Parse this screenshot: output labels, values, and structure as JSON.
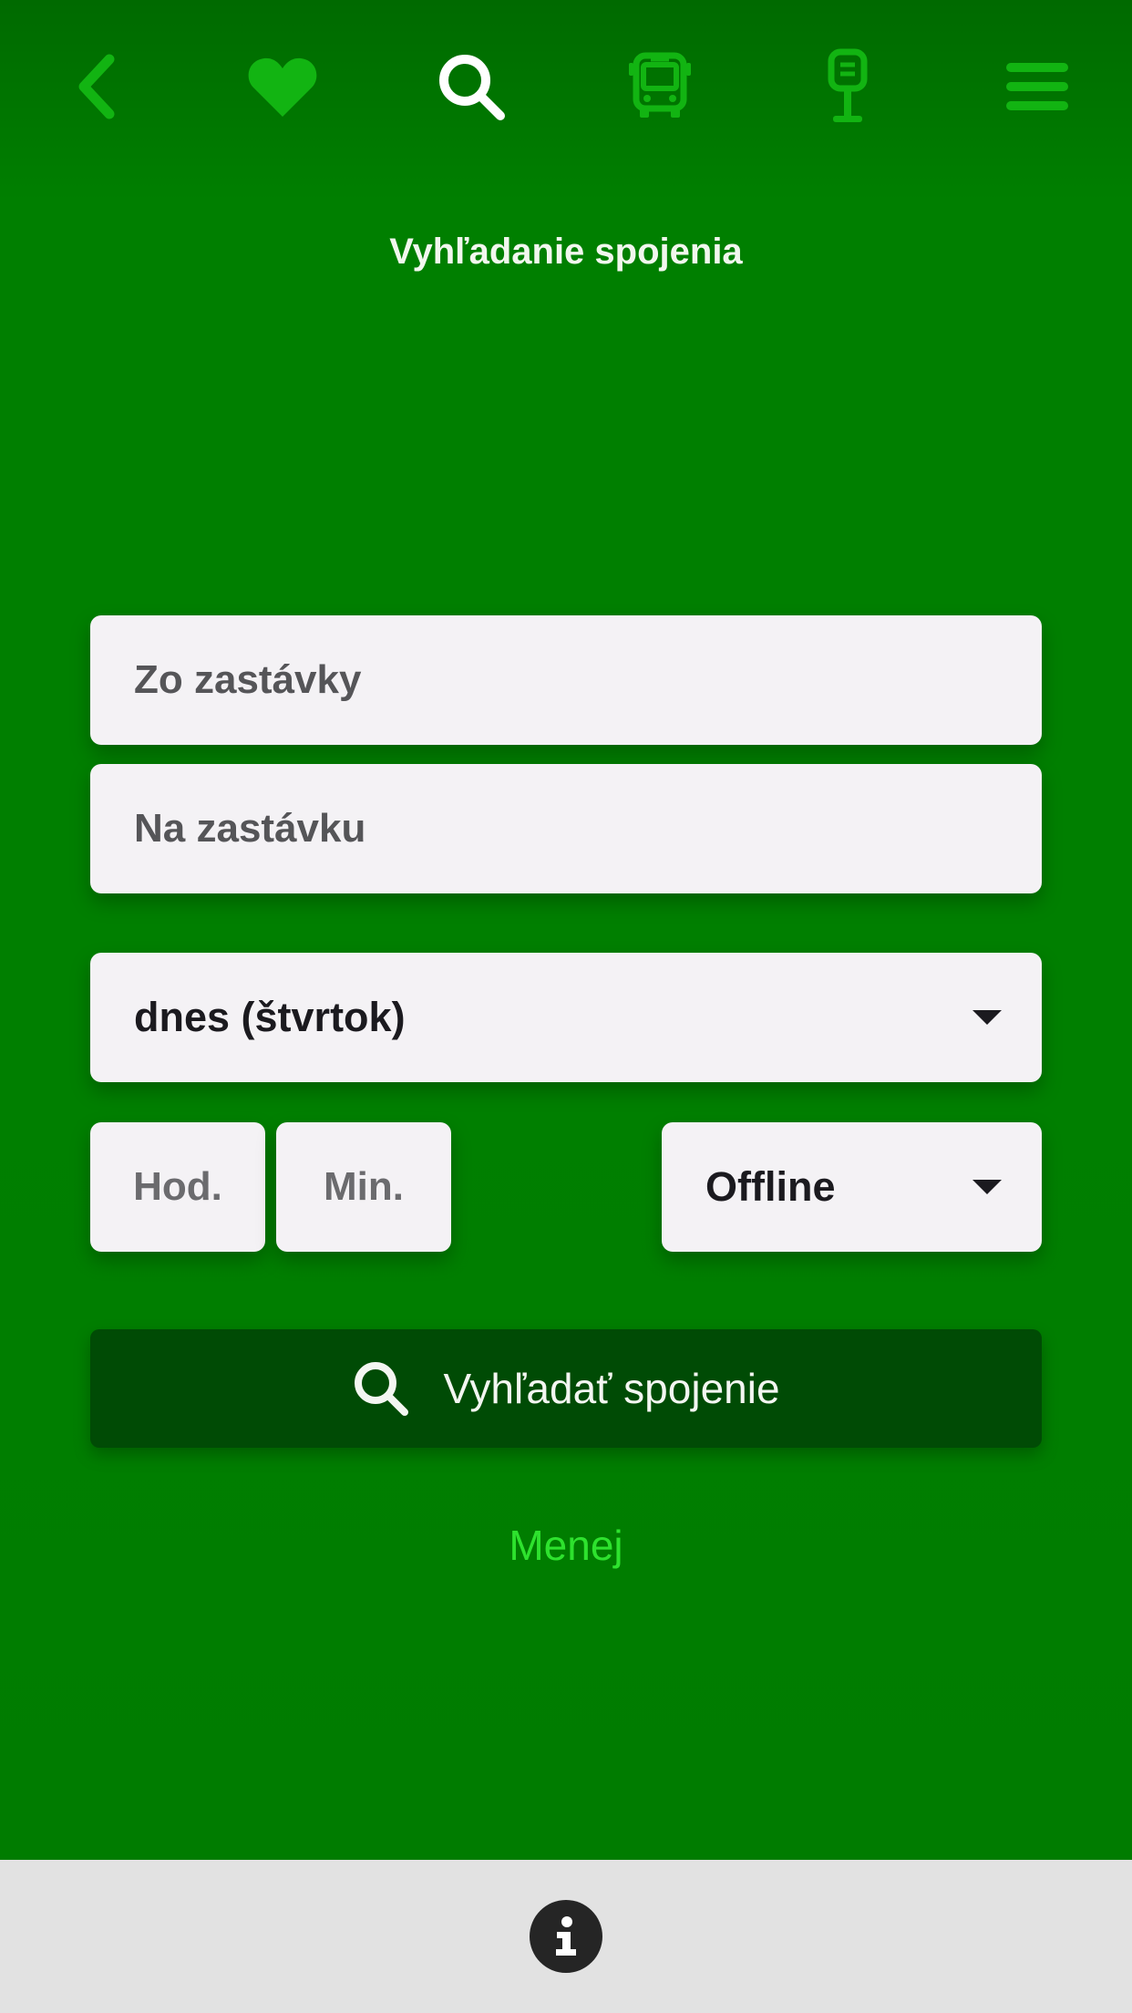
{
  "colors": {
    "background": "#007f00",
    "nav_icon": "#12b412",
    "nav_icon_active": "#ffffff",
    "button": "#004b05",
    "link": "#2ee22e",
    "footer": "#e2e2e2"
  },
  "nav": {
    "items": [
      {
        "icon": "chevron-left-icon",
        "active": false
      },
      {
        "icon": "heart-icon",
        "active": false
      },
      {
        "icon": "search-icon",
        "active": true
      },
      {
        "icon": "bus-icon",
        "active": false
      },
      {
        "icon": "bus-stop-icon",
        "active": false
      },
      {
        "icon": "menu-icon",
        "active": false
      }
    ]
  },
  "page": {
    "title": "Vyhľadanie spojenia"
  },
  "form": {
    "from_placeholder": "Zo zastávky",
    "to_placeholder": "Na zastávku",
    "date_value": "dnes (štvrtok)",
    "hour_placeholder": "Hod.",
    "minute_placeholder": "Min.",
    "mode_value": "Offline",
    "search_label": "Vyhľadať spojenie",
    "less_label": "Menej"
  },
  "footer": {
    "icon": "info-icon"
  }
}
